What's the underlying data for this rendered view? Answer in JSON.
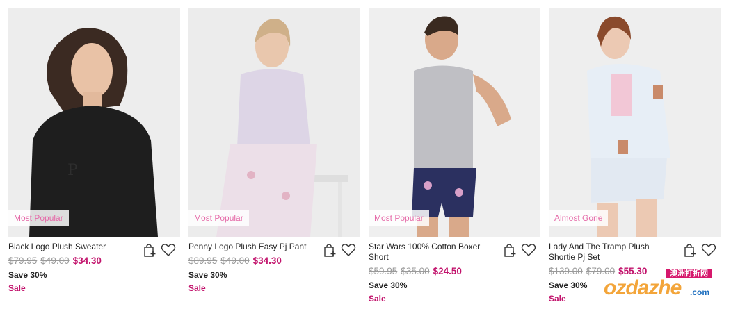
{
  "products": [
    {
      "name": "Black Logo Plush Sweater",
      "badge": "Most Popular",
      "prices": [
        "$79.95",
        "$49.00"
      ],
      "sale_price": "$34.30",
      "save": "Save 30%",
      "sale": "Sale"
    },
    {
      "name": "Penny Logo Plush Easy Pj Pant",
      "badge": "Most Popular",
      "prices": [
        "$89.95",
        "$49.00"
      ],
      "sale_price": "$34.30",
      "save": "Save 30%",
      "sale": "Sale"
    },
    {
      "name": "Star Wars 100% Cotton Boxer Short",
      "badge": "Most Popular",
      "prices": [
        "$59.95",
        "$35.00"
      ],
      "sale_price": "$24.50",
      "save": "Save 30%",
      "sale": "Sale"
    },
    {
      "name": "Lady And The Tramp Plush Shortie Pj Set",
      "badge": "Almost Gone",
      "prices": [
        "$139.00",
        "$79.00"
      ],
      "sale_price": "$55.30",
      "save": "Save 30%",
      "sale": "Sale"
    }
  ],
  "icons": {
    "bag": "shopping-bag-add-icon",
    "wishlist": "heart-icon"
  },
  "watermark": {
    "cn": "澳洲打折网",
    "main": "ozdazhe",
    "suffix": ".com"
  },
  "colors": {
    "badge_text": "#e56aa8",
    "sale": "#c2136c",
    "strike": "#9a9a9a"
  }
}
